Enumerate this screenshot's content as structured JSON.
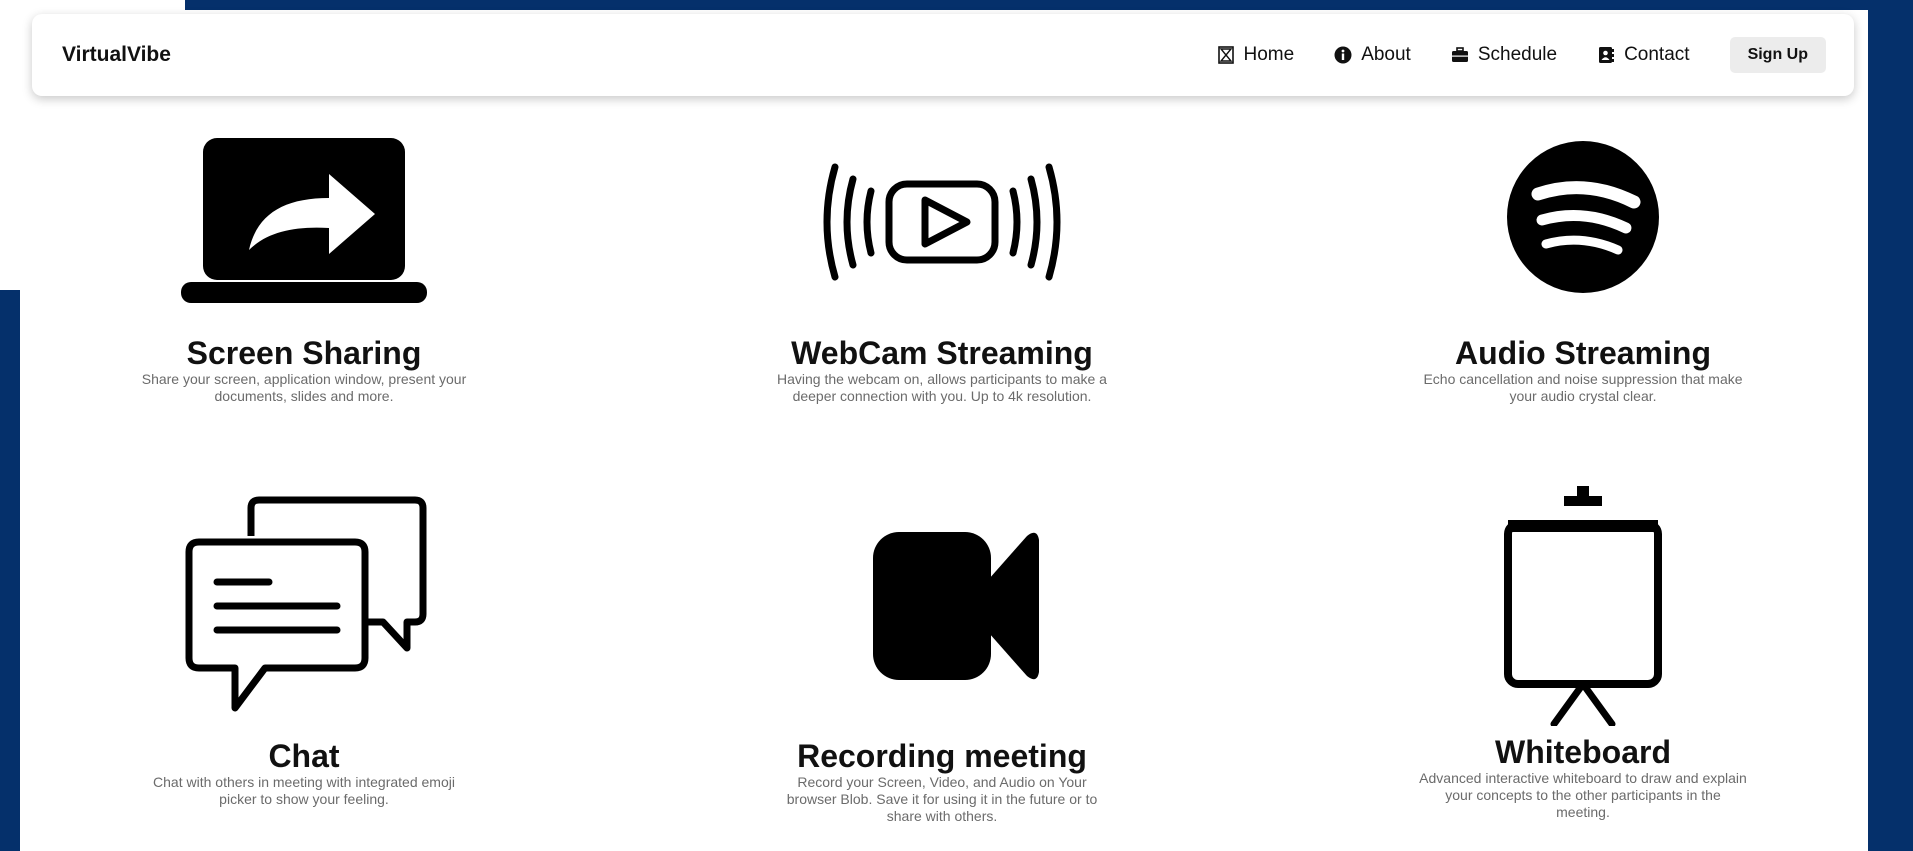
{
  "brand": "VirtualVibe",
  "nav": {
    "home": "Home",
    "about": "About",
    "schedule": "Schedule",
    "contact": "Contact",
    "signup": "Sign Up"
  },
  "features": [
    {
      "title": "Screen Sharing",
      "description": "Share your screen, application window, present your documents, slides and more.",
      "icon": "laptop-share-icon"
    },
    {
      "title": "WebCam Streaming",
      "description": "Having the webcam on, allows participants to make a deeper connection with you. Up to 4k resolution.",
      "icon": "broadcast-play-icon"
    },
    {
      "title": "Audio Streaming",
      "description": "Echo cancellation and noise suppression that make your audio crystal clear.",
      "icon": "spotify-icon"
    },
    {
      "title": "Chat",
      "description": "Chat with others in meeting with integrated emoji picker to show your feeling.",
      "icon": "chat-bubbles-icon"
    },
    {
      "title": "Recording meeting",
      "description": "Record your Screen, Video, and Audio on Your browser Blob. Save it for using it in the future or to share with others.",
      "icon": "video-camera-icon"
    },
    {
      "title": "Whiteboard",
      "description": "Advanced interactive whiteboard to draw and explain your concepts to the other participants in the meeting.",
      "icon": "whiteboard-easel-icon"
    }
  ],
  "colors": {
    "accent": "#05306b",
    "text": "#111111",
    "muted": "#6b6b6b"
  }
}
